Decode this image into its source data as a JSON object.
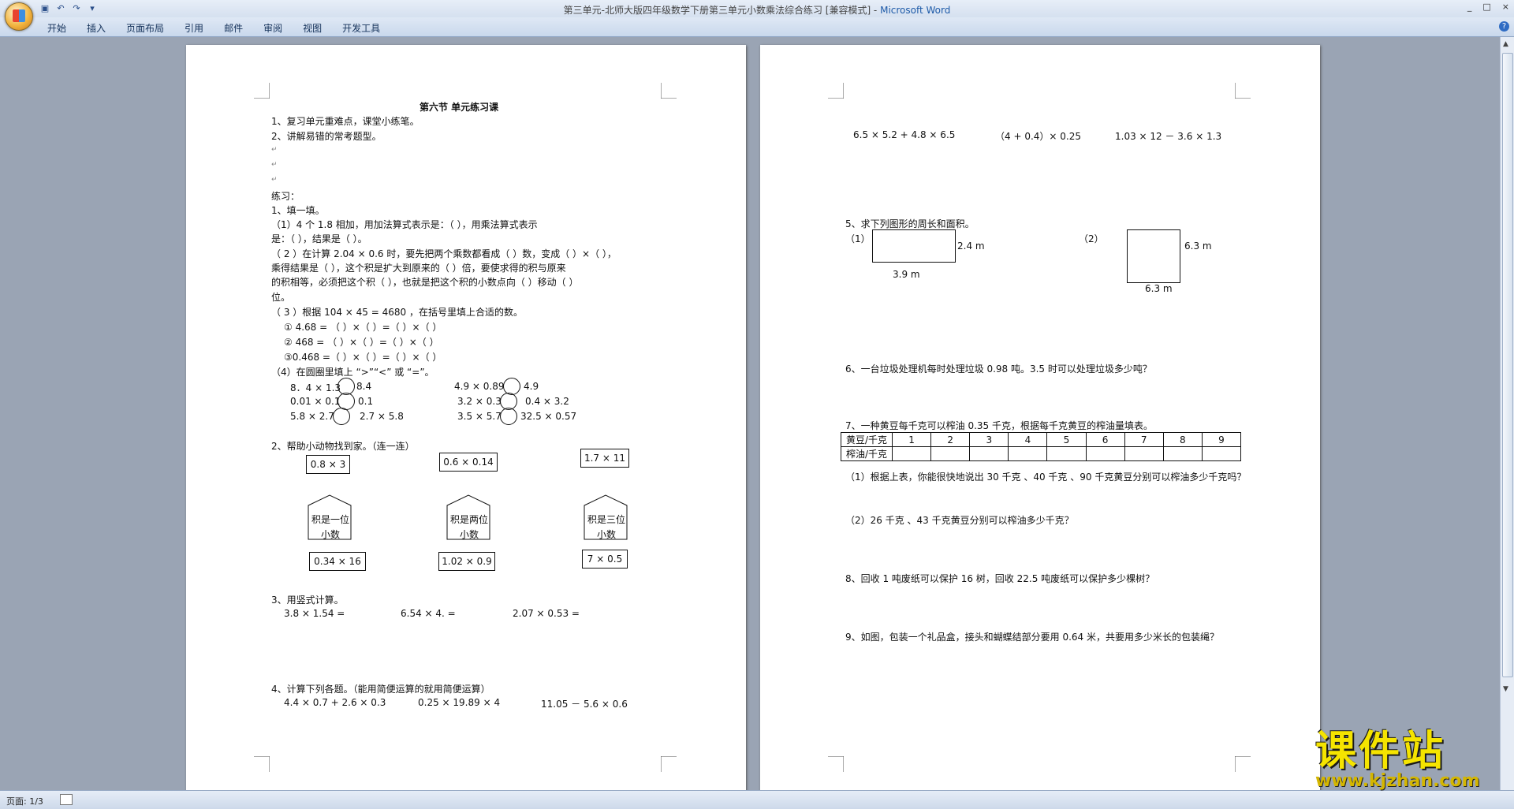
{
  "window": {
    "title_doc": "第三单元-北师大版四年级数学下册第三单元小数乘法综合练习 [兼容模式] - ",
    "title_app": "Microsoft Word",
    "controls": [
      "_",
      "□",
      "×"
    ]
  },
  "menu": {
    "tabs": [
      "开始",
      "插入",
      "页面布局",
      "引用",
      "邮件",
      "审阅",
      "视图",
      "开发工具"
    ]
  },
  "status": {
    "page": "页面: 1/3"
  },
  "watermark": {
    "text": "课件站",
    "url": "www.kjzhan.com"
  },
  "page1": {
    "heading": "第六节  单元练习课",
    "review1": "1、复习单元重难点，课堂小练笔。",
    "review2": "2、讲解易错的常考题型。",
    "practice_label": "练习：",
    "q1": "1、填一填。",
    "q1_1a": "（1）4 个 1.8 相加，用加法算式表示是：（                              ），用乘法算式表示",
    "q1_1b": "是：（              ），结果是（             ）。",
    "q1_2a": "（ 2 ）在计算 2.04 × 0.6 时，要先把两个乘数都看成（       ）数，变成（        ）×（       ），",
    "q1_2b": "乘得结果是（              ），这个积是扩大到原来的（          ）倍，要使求得的积与原来",
    "q1_2c": "的积相等，必须把这个积（            ），也就是把这个积的小数点向（          ）移动（        ）",
    "q1_2d": "位。",
    "q1_3": "（ 3 ）根据 104 × 45 = 4680 ，在括号里填上合适的数。",
    "q1_3a": "① 4.68 =  （        ）×（        ）=（        ）×（        ）",
    "q1_3b": "② 468 =  （        ）×（        ）=（        ）×（        ）",
    "q1_3c": "③0.468 =（        ）×（        ）=（        ）×（        ）",
    "q1_4": "（4）在圆圈里填上 “>”“<” 或 “=”。",
    "cmp": [
      {
        "l": "8．4 × 1.3",
        "r": "8.4"
      },
      {
        "l": "4.9 × 0.89",
        "r": "4.9"
      },
      {
        "l": "0.01 × 0.1",
        "r": "0.1"
      },
      {
        "l": "3.2 × 0.3",
        "r": "0.4 × 3.2"
      },
      {
        "l": "5.8 × 2.7",
        "r": "2.7 × 5.8"
      },
      {
        "l": "3.5 × 5.7",
        "r": "32.5 × 0.57"
      }
    ],
    "q2": "2、帮助小动物找到家。（连一连）",
    "top_boxes": [
      "0.8 × 3",
      "0.6 × 0.14",
      "1.7 × 11"
    ],
    "houses": [
      [
        "积是一位",
        "小数"
      ],
      [
        "积是两位",
        "小数"
      ],
      [
        "积是三位",
        "小数"
      ]
    ],
    "bottom_boxes": [
      "0.34 × 16",
      "1.02 × 0.9",
      "7 × 0.5"
    ],
    "q3": "3、用竖式计算。",
    "q3_items": [
      "3.8 × 1.54 =",
      "6.54 × 4. =",
      "2.07 × 0.53 ="
    ],
    "q4": "4、计算下列各题。（能用简便运算的就用简便运算）",
    "q4_items": [
      "4.4 × 0.7 + 2.6 × 0.3",
      "0.25 × 19.89 × 4",
      "11.05 －  5.6 × 0.6"
    ]
  },
  "page2": {
    "exprs": [
      "6.5 × 5.2 + 4.8 × 6.5",
      "（4 + 0.4）× 0.25",
      "1.03 × 12 － 3.6 × 1.3"
    ],
    "q5": "5、求下列图形的周长和面积。",
    "fig1_label": "（1）",
    "fig1_w": "3.9 m",
    "fig1_h": "2.4 m",
    "fig2_label": "（2）",
    "fig2_w": "6.3 m",
    "fig2_h": "6.3 m",
    "q6": "6、一台垃圾处理机每时处理垃圾 0.98 吨。3.5 时可以处理垃圾多少吨？",
    "q7": "7、一种黄豆每千克可以榨油 0.35 千克，根据每千克黄豆的榨油量填表。",
    "table_row1_head": "黄豆/千克",
    "table_row1": [
      "1",
      "2",
      "3",
      "4",
      "5",
      "6",
      "7",
      "8",
      "9"
    ],
    "table_row2_head": "榨油/千克",
    "q7_1": "（1）根据上表，你能很快地说出 30 千克 、40 千克 、90 千克黄豆分别可以榨油多少千克吗？",
    "q7_2": "（2）26 千克 、43 千克黄豆分别可以榨油多少千克？",
    "q8": "8、回收 1 吨废纸可以保护 16 树，回收 22.5 吨废纸可以保护多少棵树？",
    "q9": "9、如图，包装一个礼品盒，接头和蝴蝶结部分要用 0.64 米，共要用多少米长的包装绳？"
  }
}
